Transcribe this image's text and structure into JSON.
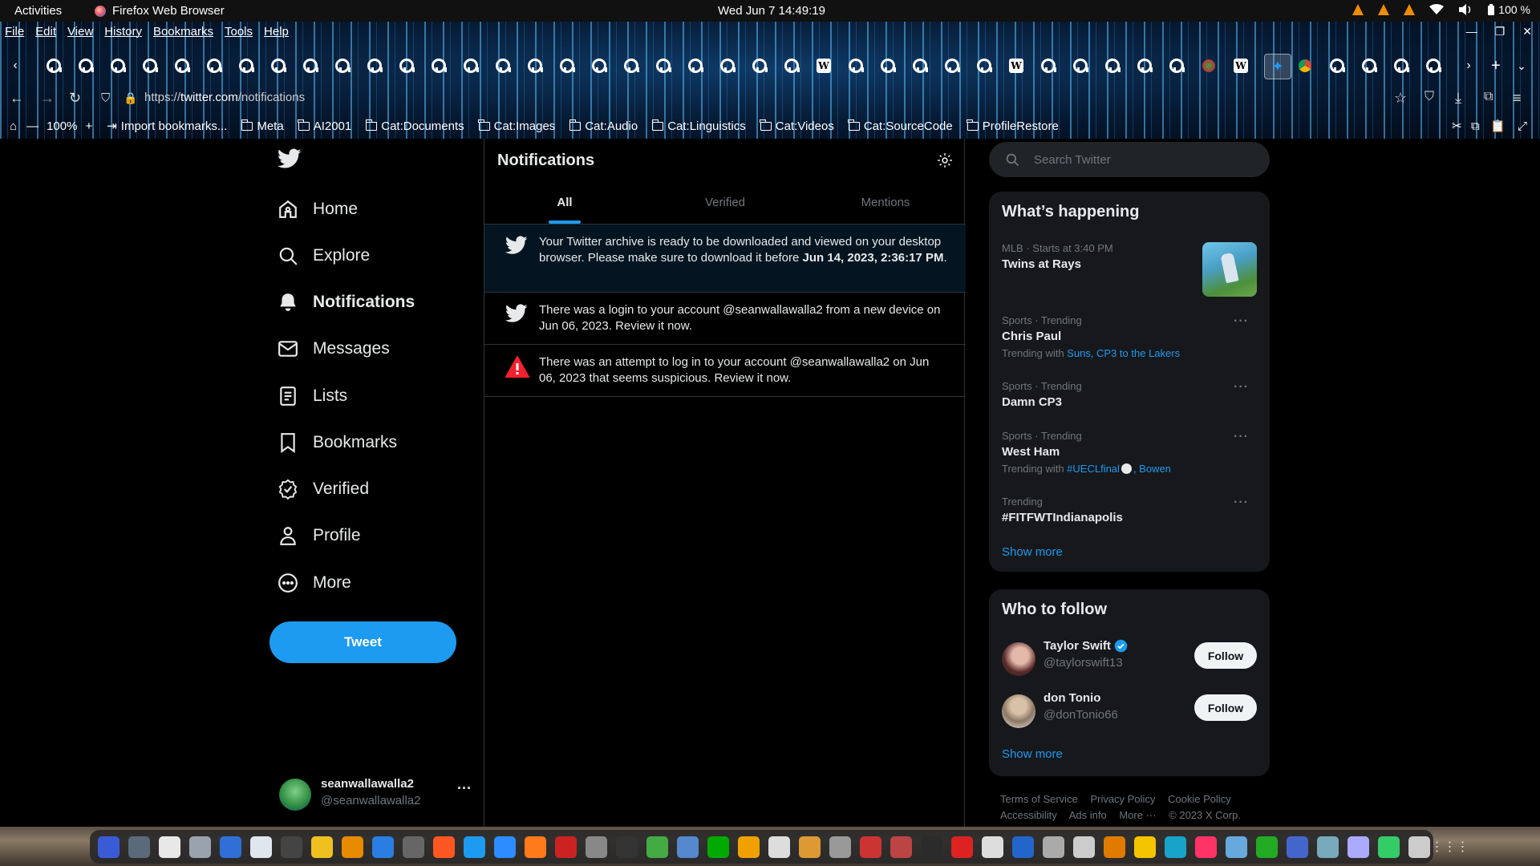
{
  "system": {
    "activities": "Activities",
    "app_name": "Firefox Web Browser",
    "clock": "Wed Jun 7  14:49:19",
    "battery": "100 %"
  },
  "browser": {
    "menu": [
      "File",
      "Edit",
      "View",
      "History",
      "Bookmarks",
      "Tools",
      "Help"
    ],
    "url_prefix": "https://",
    "url_host": "twitter.com",
    "url_path": "/notifications",
    "zoom": "100%",
    "bookmarks": [
      "Import bookmarks...",
      "Meta",
      "AI2001",
      "Cat:Documents",
      "Cat:Images",
      "Cat:Audio",
      "Cat:Linguistics",
      "Cat:Videos",
      "Cat:SourceCode",
      "ProfileRestore"
    ],
    "tab_icons": [
      "github",
      "github",
      "github",
      "github",
      "github",
      "github",
      "github",
      "github",
      "github",
      "github",
      "github",
      "github",
      "github",
      "github",
      "github",
      "github",
      "github",
      "github",
      "github",
      "github",
      "github",
      "github",
      "github",
      "github",
      "wikipedia",
      "github",
      "github",
      "github",
      "github",
      "github",
      "wikipedia",
      "github",
      "github",
      "github",
      "github",
      "github",
      "firefox",
      "wikipedia",
      "twitter",
      "chrome",
      "github",
      "github",
      "github",
      "github"
    ]
  },
  "twitter": {
    "nav": [
      {
        "label": "Home",
        "icon": "home-icon"
      },
      {
        "label": "Explore",
        "icon": "search-icon"
      },
      {
        "label": "Notifications",
        "icon": "bell-icon"
      },
      {
        "label": "Messages",
        "icon": "envelope-icon"
      },
      {
        "label": "Lists",
        "icon": "list-icon"
      },
      {
        "label": "Bookmarks",
        "icon": "bookmark-icon"
      },
      {
        "label": "Verified",
        "icon": "verified-icon"
      },
      {
        "label": "Profile",
        "icon": "person-icon"
      },
      {
        "label": "More",
        "icon": "more-circle-icon"
      }
    ],
    "tweet_button": "Tweet",
    "account": {
      "name": "seanwallawalla2",
      "handle": "@seanwallawalla2"
    },
    "page_title": "Notifications",
    "tabs": [
      "All",
      "Verified",
      "Mentions"
    ],
    "notifications": [
      {
        "icon": "twitter-bird-icon",
        "text": "Your Twitter archive is ready to be downloaded and viewed on your desktop browser. Please make sure to download it before ",
        "bold": "Jun 14, 2023, 2:36:17 PM",
        "tail": "."
      },
      {
        "icon": "twitter-bird-icon",
        "text": "There was a login to your account @seanwallawalla2 from a new device on Jun 06, 2023. Review it now."
      },
      {
        "icon": "warning-icon",
        "text": "There was an attempt to log in to your account @seanwallawalla2 on Jun 06, 2023 that seems suspicious. Review it now."
      }
    ],
    "search_placeholder": "Search Twitter",
    "whats_happening": {
      "title": "What’s happening",
      "items": [
        {
          "meta": "MLB · Starts at 3:40 PM",
          "name": "Twins at Rays"
        },
        {
          "meta": "Sports · Trending",
          "name": "Chris Paul",
          "with_prefix": "Trending with ",
          "with_links": "Suns, CP3 to the Lakers"
        },
        {
          "meta": "Sports · Trending",
          "name": "Damn CP3"
        },
        {
          "meta": "Sports · Trending",
          "name": "West Ham",
          "with_prefix": "Trending with ",
          "with_links": "#UECLfinal",
          "with_links2": ", Bowen"
        },
        {
          "meta": "Trending",
          "name": "#FITFWTIndianapolis"
        }
      ],
      "show_more": "Show more"
    },
    "who_to_follow": {
      "title": "Who to follow",
      "people": [
        {
          "name": "Taylor Swift",
          "handle": "@taylorswift13",
          "verified": true,
          "button": "Follow"
        },
        {
          "name": "don Tonio",
          "handle": "@donTonio66",
          "verified": false,
          "button": "Follow"
        }
      ],
      "show_more": "Show more"
    },
    "footer": [
      "Terms of Service",
      "Privacy Policy",
      "Cookie Policy",
      "Accessibility",
      "Ads info",
      "More ···",
      "© 2023 X Corp."
    ]
  },
  "colors": {
    "accent": "#1d9bf0",
    "background": "#000000",
    "panel": "#16181c",
    "warning": "#f4212e"
  }
}
